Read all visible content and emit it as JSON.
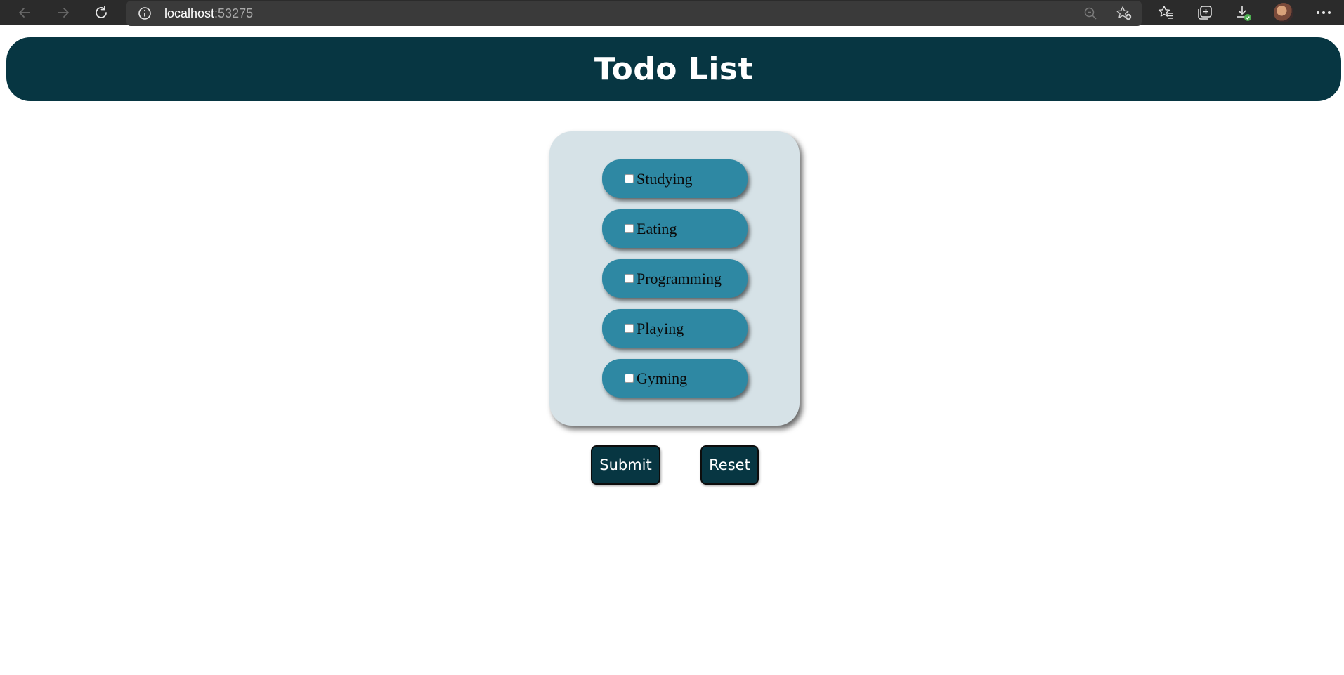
{
  "browser": {
    "address_host": "localhost",
    "address_port": ":53275",
    "icons": {
      "back": "arrow-left-icon",
      "forward": "arrow-right-icon",
      "refresh": "refresh-icon",
      "site_info": "info-icon",
      "zoom": "zoom-out-icon",
      "add_favorite": "star-add-icon",
      "favorites": "favorites-icon",
      "collections": "collections-icon",
      "downloads": "download-icon",
      "profile": "avatar",
      "menu": "more-icon"
    }
  },
  "header": {
    "title": "Todo List"
  },
  "todo": {
    "items": [
      {
        "label": "Studying",
        "checked": false
      },
      {
        "label": "Eating",
        "checked": false
      },
      {
        "label": "Programming",
        "checked": false
      },
      {
        "label": "Playing",
        "checked": false
      },
      {
        "label": "Gyming",
        "checked": false
      }
    ]
  },
  "actions": {
    "submit_label": "Submit",
    "reset_label": "Reset"
  },
  "colors": {
    "header_bg": "#073642",
    "card_bg": "#d6e2e7",
    "item_bg": "#2e88a3",
    "button_bg": "#073642",
    "chrome_bg": "#2b2b2b"
  }
}
